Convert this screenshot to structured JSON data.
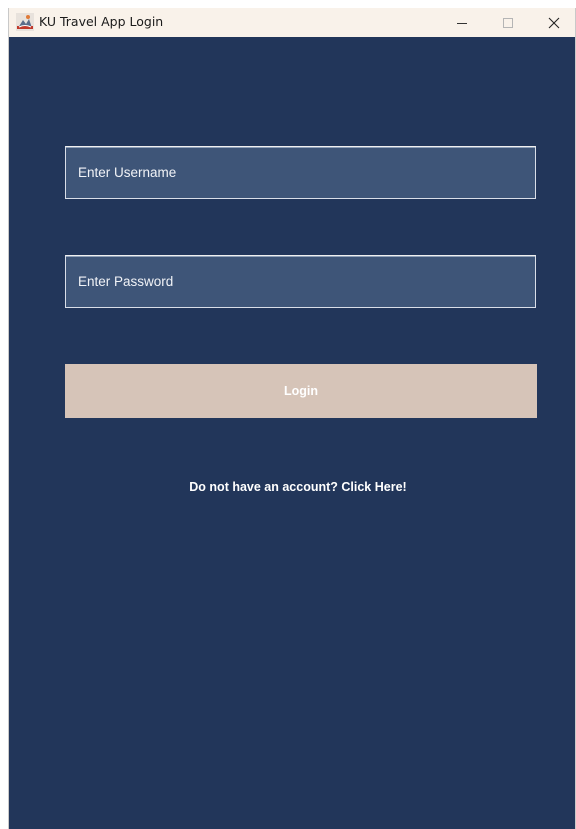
{
  "window": {
    "title": "KU Travel App Login",
    "minimize_glyph": "—",
    "maximize_glyph": "☐",
    "close_glyph": "✕"
  },
  "form": {
    "username_placeholder": "Enter Username",
    "username_value": "",
    "password_placeholder": "Enter Password",
    "password_value": "",
    "login_label": "Login",
    "signup_link_text": "Do not have an account? Click Here!"
  },
  "colors": {
    "background": "#22365a",
    "field_background": "#3e5578",
    "button_background": "#d6c4b8",
    "titlebar_background": "#f9f2ea",
    "text": "#ffffff"
  },
  "icons": {
    "app": "java-app-icon",
    "minimize": "minimize-icon",
    "maximize": "maximize-icon",
    "close": "close-icon"
  }
}
